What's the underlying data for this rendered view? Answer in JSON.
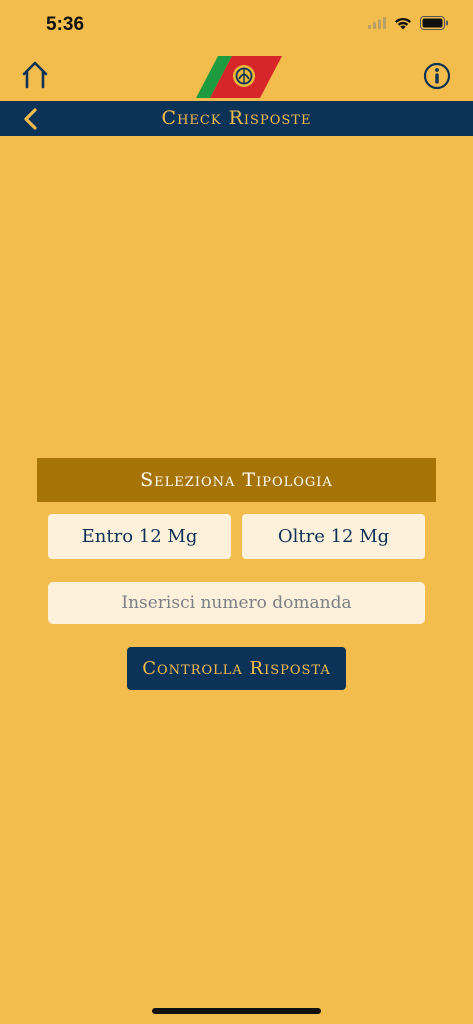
{
  "status_bar": {
    "time": "5:36"
  },
  "header": {
    "home_icon": "home-icon",
    "logo_icon": "coast-guard-logo",
    "info_icon": "info-icon"
  },
  "nav": {
    "title": "Check Risposte",
    "back_icon": "chevron-left-icon"
  },
  "main": {
    "section_title": "Seleziona Tipologia",
    "type_buttons": [
      "Entro 12 Mg",
      "Oltre 12 Mg"
    ],
    "question_placeholder": "Inserisci numero domanda",
    "check_label": "Controlla Risposta"
  },
  "colors": {
    "background": "#F2BD4C",
    "navy": "#0D3257",
    "section": "#A67305",
    "field": "#FDF1DC"
  }
}
